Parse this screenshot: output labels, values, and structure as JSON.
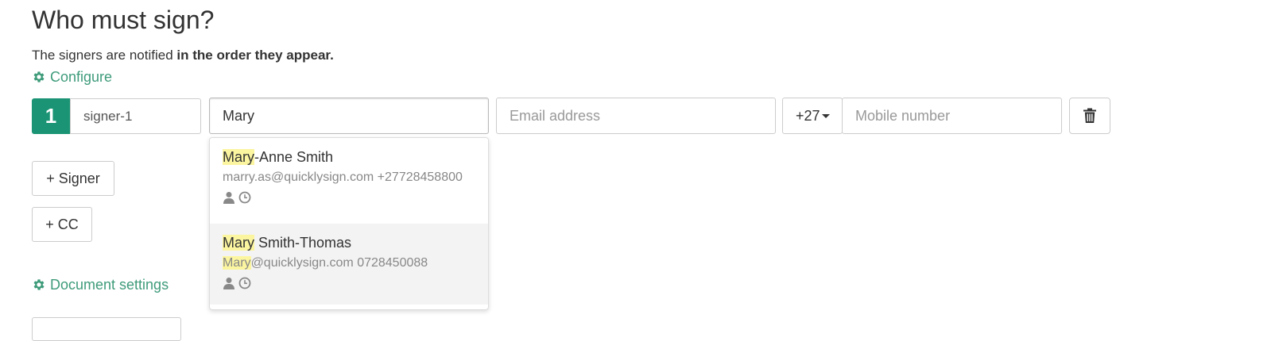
{
  "page": {
    "title": "Who must sign?",
    "notice_prefix": "The signers are notified ",
    "notice_bold": "in the order they appear.",
    "configure_label": "Configure",
    "document_settings_label": "Document settings"
  },
  "signer": {
    "number": "1",
    "role": "signer-1",
    "name_value": "Mary",
    "email_placeholder": "Email address",
    "country_code": "+27",
    "mobile_placeholder": "Mobile number"
  },
  "buttons": {
    "add_signer": "+ Signer",
    "add_cc": "+ CC"
  },
  "suggestions": [
    {
      "name_match": "Mary",
      "name_rest": "-Anne Smith",
      "email_match": "",
      "email_rest": "marry.as@quicklysign.com",
      "phone": "+27728458800"
    },
    {
      "name_match": "Mary",
      "name_rest": " Smith-Thomas",
      "email_match": "Mary",
      "email_rest": "@quicklysign.com",
      "phone": "0728450088"
    }
  ],
  "colors": {
    "accent": "#1a9474",
    "link": "#3e9b7a",
    "highlight": "#fbf5a0"
  },
  "icons": [
    "gear-icon",
    "trash-icon",
    "user-icon",
    "clock-icon",
    "caret-down-icon"
  ]
}
